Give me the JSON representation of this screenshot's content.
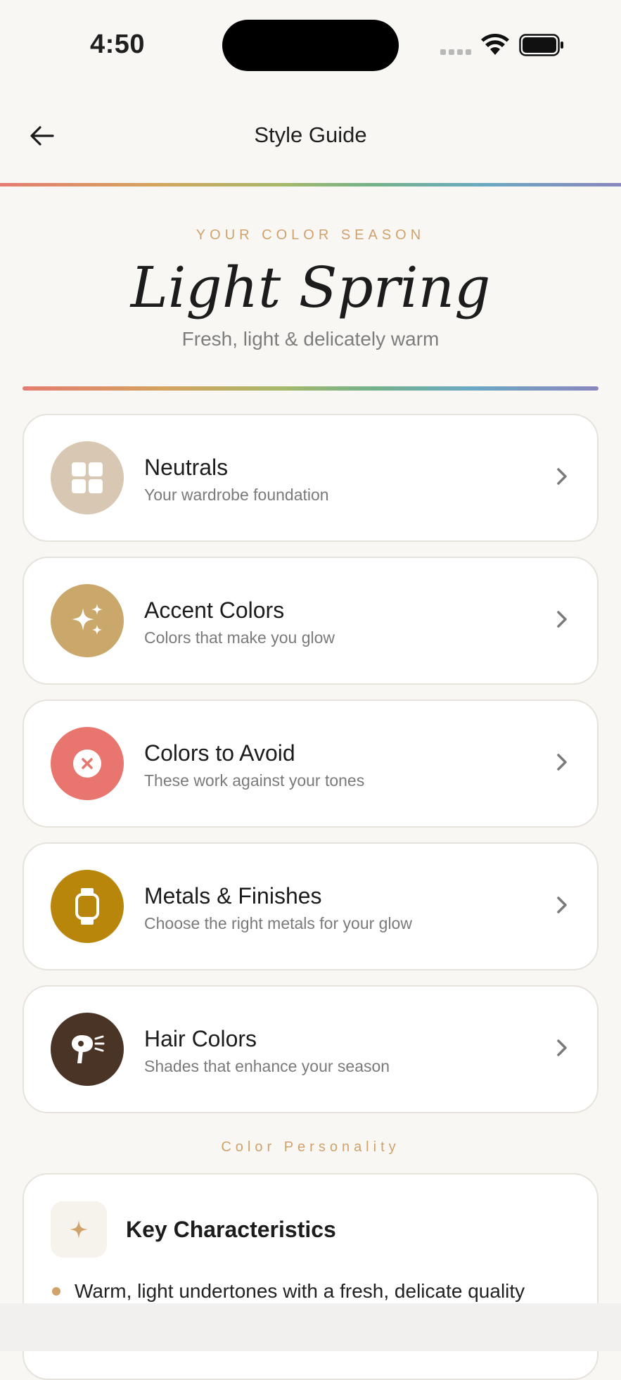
{
  "status": {
    "time": "4:50"
  },
  "nav": {
    "title": "Style Guide"
  },
  "hero": {
    "eyebrow": "YOUR COLOR SEASON",
    "title": "Light Spring",
    "subtitle": "Fresh, light & delicately warm"
  },
  "colors": {
    "neutrals": "#d8c7b2",
    "accent": "#caa86c",
    "avoid": "#e8756e",
    "metals": "#b8860b",
    "hair": "#4a3426",
    "gold_text": "#cfa26b"
  },
  "cards": [
    {
      "title": "Neutrals",
      "subtitle": "Your wardrobe foundation",
      "icon": "grid-icon"
    },
    {
      "title": "Accent Colors",
      "subtitle": "Colors that make you glow",
      "icon": "sparkles-icon"
    },
    {
      "title": "Colors to Avoid",
      "subtitle": "These work against your tones",
      "icon": "x-circle-icon"
    },
    {
      "title": "Metals & Finishes",
      "subtitle": "Choose the right metals for your glow",
      "icon": "watch-icon"
    },
    {
      "title": "Hair Colors",
      "subtitle": "Shades that enhance your season",
      "icon": "hair-dryer-icon"
    }
  ],
  "personality": {
    "section_label": "Color Personality",
    "card_title": "Key Characteristics",
    "items": [
      "Warm, light undertones with a fresh, delicate quality"
    ]
  }
}
